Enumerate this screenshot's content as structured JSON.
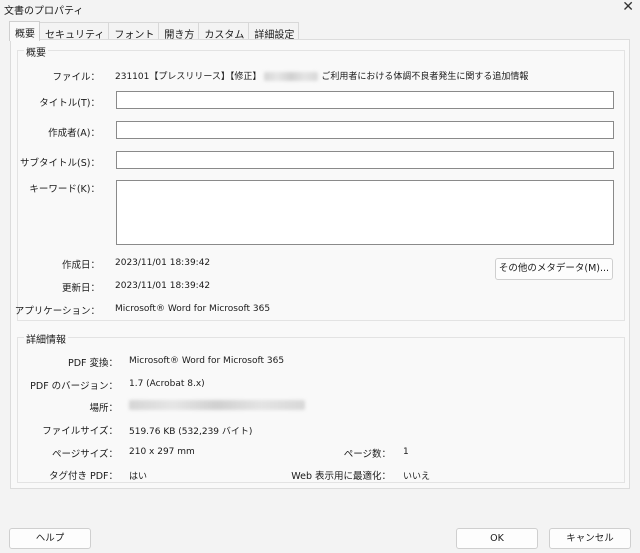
{
  "window": {
    "title": "文書のプロパティ",
    "close_glyph": "✕",
    "close_icon": "close-icon"
  },
  "tabs": [
    {
      "label": "概要",
      "active": true
    },
    {
      "label": "セキュリティ"
    },
    {
      "label": "フォント"
    },
    {
      "label": "開き方"
    },
    {
      "label": "カスタム"
    },
    {
      "label": "詳細設定"
    }
  ],
  "summary": {
    "group_title": "概要",
    "file_label": "ファイル：",
    "file_value_prefix": "231101【プレスリリース】【修正】",
    "file_value_suffix": "ご利用者における体調不良者発生に関する追加情報",
    "title_label": "タイトル(T)：",
    "title_value": "",
    "author_label": "作成者(A)：",
    "author_value": "",
    "subject_label": "サブタイトル(S)：",
    "subject_value": "",
    "keywords_label": "キーワード(K)：",
    "keywords_value": "",
    "created_label": "作成日：",
    "created_value": "2023/11/01 18:39:42",
    "modified_label": "更新日：",
    "modified_value": "2023/11/01 18:39:42",
    "app_label": "アプリケーション：",
    "app_value": "Microsoft® Word for Microsoft 365",
    "metadata_button": "その他のメタデータ(M)..."
  },
  "details": {
    "group_title": "詳細情報",
    "producer_label": "PDF 変換：",
    "producer_value": "Microsoft® Word for Microsoft 365",
    "version_label": "PDF のバージョン：",
    "version_value": "1.7 (Acrobat 8.x)",
    "location_label": "場所：",
    "filesize_label": "ファイルサイズ：",
    "filesize_value": "519.76 KB (532,239 バイト)",
    "pagesize_label": "ページサイズ：",
    "pagesize_value": "210 x 297 mm",
    "pages_label": "ページ数：",
    "pages_value": "1",
    "tagged_label": "タグ付き PDF：",
    "tagged_value": "はい",
    "fastweb_label": "Web 表示用に最適化：",
    "fastweb_value": "いいえ"
  },
  "footer": {
    "help": "ヘルプ",
    "ok": "OK",
    "cancel": "キャンセル"
  }
}
